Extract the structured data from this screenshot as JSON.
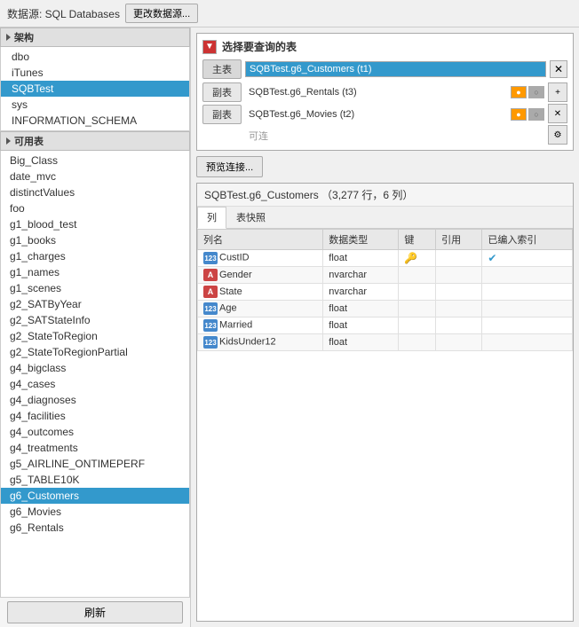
{
  "topbar": {
    "datasource_label": "数据源: SQL Databases",
    "change_btn": "更改数据源..."
  },
  "left": {
    "schema_section": "架构",
    "schemas": [
      {
        "name": "dbo",
        "selected": false
      },
      {
        "name": "iTunes",
        "selected": false
      },
      {
        "name": "SQBTest",
        "selected": true
      },
      {
        "name": "sys",
        "selected": false
      },
      {
        "name": "INFORMATION_SCHEMA",
        "selected": false
      }
    ],
    "table_section": "可用表",
    "tables": [
      {
        "name": "Big_Class",
        "selected": false
      },
      {
        "name": "date_mvc",
        "selected": false
      },
      {
        "name": "distinctValues",
        "selected": false
      },
      {
        "name": "foo",
        "selected": false
      },
      {
        "name": "g1_blood_test",
        "selected": false
      },
      {
        "name": "g1_books",
        "selected": false
      },
      {
        "name": "g1_charges",
        "selected": false
      },
      {
        "name": "g1_names",
        "selected": false
      },
      {
        "name": "g1_scenes",
        "selected": false
      },
      {
        "name": "g2_SATByYear",
        "selected": false
      },
      {
        "name": "g2_SATStateInfo",
        "selected": false
      },
      {
        "name": "g2_StateToRegion",
        "selected": false
      },
      {
        "name": "g2_StateToRegionPartial",
        "selected": false
      },
      {
        "name": "g4_bigclass",
        "selected": false
      },
      {
        "name": "g4_cases",
        "selected": false
      },
      {
        "name": "g4_diagnoses",
        "selected": false
      },
      {
        "name": "g4_facilities",
        "selected": false
      },
      {
        "name": "g4_outcomes",
        "selected": false
      },
      {
        "name": "g4_treatments",
        "selected": false
      },
      {
        "name": "g5_AIRLINE_ONTIMEPERF",
        "selected": false
      },
      {
        "name": "g5_TABLE10K",
        "selected": false
      },
      {
        "name": "g6_Customers",
        "selected": true
      },
      {
        "name": "g6_Movies",
        "selected": false
      },
      {
        "name": "g6_Rentals",
        "selected": false
      }
    ],
    "refresh_btn": "刷新"
  },
  "right": {
    "select_table_title": "选择要查询的表",
    "main_table_btn": "主表",
    "sub_table_btn": "副表",
    "main_table_name": "SQBTest.g6_Customers (t1)",
    "sub_table1_name": "SQBTest.g6_Rentals (t3)",
    "sub_table2_name": "SQBTest.g6_Movies (t2)",
    "kelink_text": "可连",
    "preview_btn": "预览连接...",
    "table_info_title": "SQBTest.g6_Customers   （3,277 行，6 列）",
    "tab_col": "列",
    "tab_preview": "表快照",
    "columns": {
      "headers": [
        "列名",
        "数据类型",
        "键",
        "引用",
        "已编入索引"
      ],
      "rows": [
        {
          "name": "CustID",
          "type": "float",
          "icon": "123",
          "key": true,
          "ref": false,
          "indexed": true
        },
        {
          "name": "Gender",
          "type": "nvarchar",
          "icon": "A",
          "key": false,
          "ref": false,
          "indexed": false
        },
        {
          "name": "State",
          "type": "nvarchar",
          "icon": "A",
          "key": false,
          "ref": false,
          "indexed": false
        },
        {
          "name": "Age",
          "type": "float",
          "icon": "123",
          "key": false,
          "ref": false,
          "indexed": false
        },
        {
          "name": "Married",
          "type": "float",
          "icon": "123",
          "key": false,
          "ref": false,
          "indexed": false
        },
        {
          "name": "KidsUnder12",
          "type": "float",
          "icon": "123",
          "key": false,
          "ref": false,
          "indexed": false
        }
      ]
    }
  }
}
